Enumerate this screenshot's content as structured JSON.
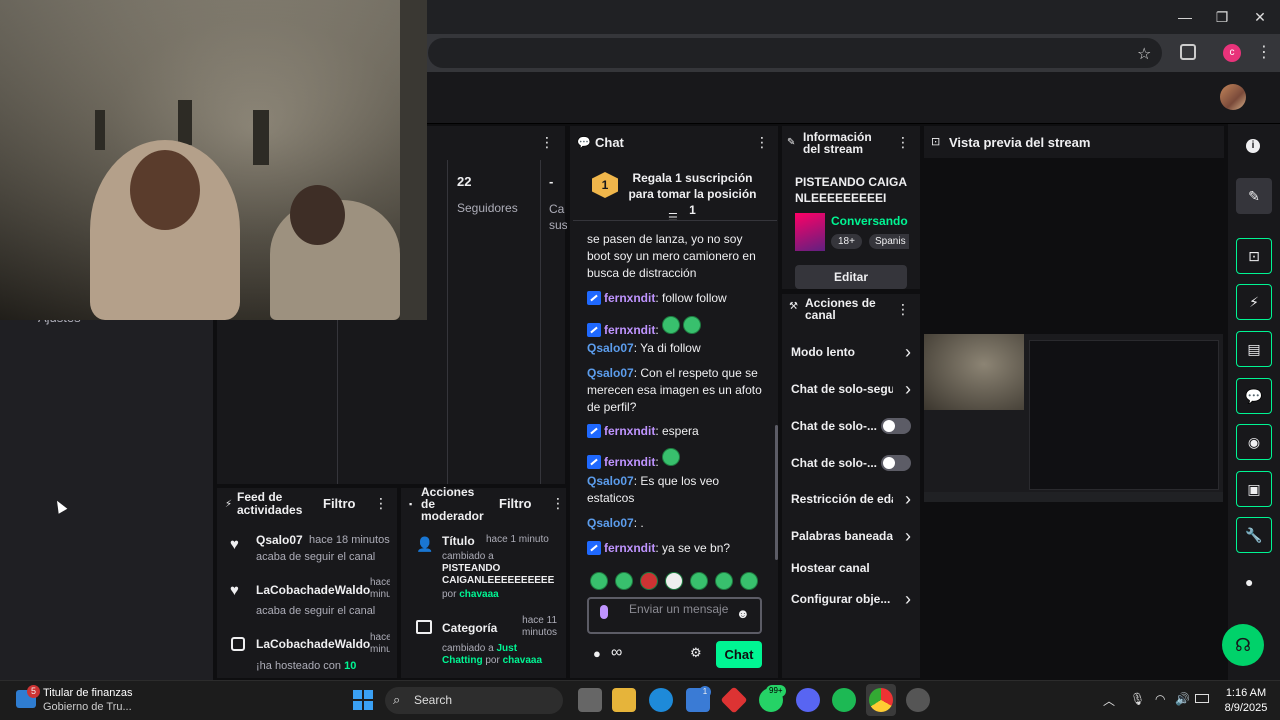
{
  "browser": {
    "minimize": "—",
    "maximize": "❐",
    "close": "✕",
    "profile_initial": "c"
  },
  "quick_stats": {
    "followers_value": "22",
    "followers_label": "Seguidores",
    "other_value": "-",
    "other_label": "Ca sus"
  },
  "sidebar": {
    "partial_label": "Ajustes"
  },
  "chat": {
    "title": "Chat",
    "gift_banner": "Regala 1 suscripción para tomar la posición 1",
    "gift_rank": "1",
    "messages": [
      {
        "user": "",
        "text": "se pasen de lanza, yo no soy boot soy un mero camionero en busca de distracción"
      },
      {
        "user": "fernxndit",
        "text": ": follow follow"
      },
      {
        "user": "fernxndit",
        "text": ":"
      },
      {
        "user": "Qsalo07",
        "text": ": Ya di follow"
      },
      {
        "user": "Qsalo07",
        "text": ": Con el respeto que se merecen esa imagen es un afoto de perfil?"
      },
      {
        "user": "fernxndit",
        "text": ": espera"
      },
      {
        "user": "fernxndit",
        "text": ":"
      },
      {
        "user": "Qsalo07",
        "text": ": Es que los veo estaticos"
      },
      {
        "user": "Qsalo07",
        "text": ": ."
      },
      {
        "user": "fernxndit",
        "text": ": ya se ve bn?"
      }
    ],
    "input_placeholder": "Enviar un mensaje",
    "points": "∞",
    "send_label": "Chat"
  },
  "stream_info": {
    "title": "Información del stream",
    "stream_title": "PISTEANDO CAIGANLEEEEEEEEEI",
    "category": "Conversando",
    "tags": [
      "18+",
      "Spanis"
    ],
    "edit_label": "Editar"
  },
  "channel_actions": {
    "title": "Acciones de canal",
    "items": [
      {
        "label": "Modo lento",
        "control": "arrow"
      },
      {
        "label": "Chat de solo-segu",
        "control": "arrow"
      },
      {
        "label": "Chat de solo-...",
        "control": "toggle"
      },
      {
        "label": "Chat de solo-...",
        "control": "toggle"
      },
      {
        "label": "Restricción de eda",
        "control": "arrow"
      },
      {
        "label": "Palabras baneada",
        "control": "arrow"
      },
      {
        "label": "Hostear canal",
        "control": "none"
      },
      {
        "label": "Configurar obje...",
        "control": "arrow"
      }
    ]
  },
  "preview": {
    "title": "Vista previa del stream"
  },
  "activity_feed": {
    "title": "Feed de actividades",
    "filter_label": "Filtro",
    "items": [
      {
        "user": "Qsalo07",
        "time": "hace 18 minutos",
        "desc": "acaba de seguir el canal"
      },
      {
        "user": "LaCobachadeWaldo",
        "time": "hace minu",
        "desc": "acaba de seguir el canal"
      },
      {
        "user": "LaCobachadeWaldo",
        "time": "hace minu",
        "desc": "¡ha hosteado con",
        "count": "10"
      }
    ]
  },
  "mod_actions": {
    "title": "Acciones de moderador",
    "filter_label": "Filtro",
    "items": [
      {
        "kind": "Título",
        "time": "hace 1 minuto",
        "line1": "cambiado a",
        "value": "PISTEANDO CAIGANLEEEEEEEEEE",
        "by_label": "por",
        "by": "chavaaa"
      },
      {
        "kind": "Categoría",
        "time": "hace 11 minutos",
        "line1": "cambiado a",
        "value": "Just Chatting",
        "by_label": "por",
        "by": "chavaaa"
      }
    ]
  },
  "taskbar": {
    "notification_count": "5",
    "widget_title": "Titular de finanzas",
    "widget_sub": "Gobierno de Tru...",
    "search_label": "Search",
    "whatsapp_badge": "99+",
    "store_badge": "1",
    "time": "1:16 AM",
    "date": "8/9/2025"
  }
}
